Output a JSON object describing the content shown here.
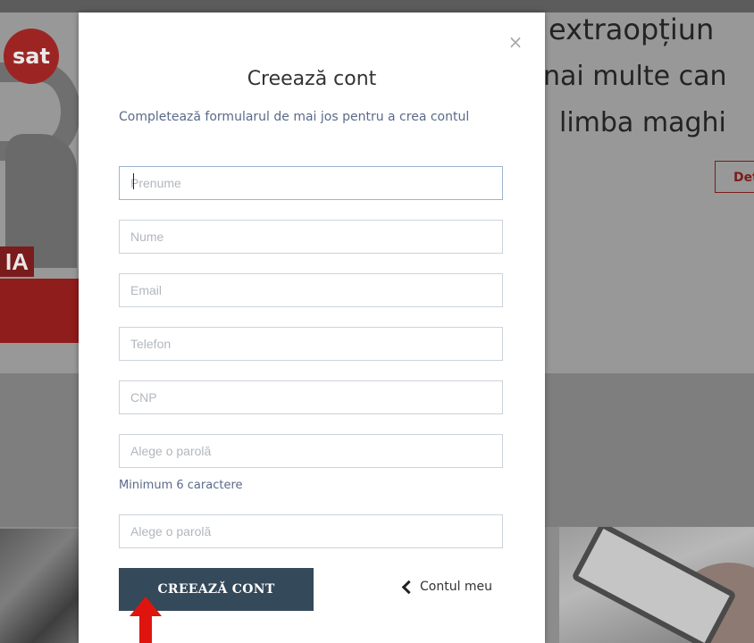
{
  "background": {
    "logo_text": "sat",
    "badge_text": "IA",
    "hero_lines": [
      "extraopțiun",
      "nai multe can",
      "limba maghi"
    ],
    "details_button": "Det"
  },
  "modal": {
    "title": "Creează cont",
    "subtitle": "Completează formularul de mai jos pentru a crea contul",
    "close_glyph": "×",
    "fields": {
      "first_name": "Prenume",
      "last_name": "Nume",
      "email": "Email",
      "phone": "Telefon",
      "cnp": "CNP",
      "password": "Alege o parolă",
      "password_confirm": "Alege o parolă"
    },
    "password_hint": "Minimum 6 caractere",
    "submit_label": "CREEAZĂ CONT",
    "account_link": "Contul meu"
  },
  "icons": {
    "close": "close-icon",
    "chevron": "chevron-left-icon",
    "annotation": "red-arrow-up-icon"
  },
  "colors": {
    "button_bg": "#34495a",
    "link_text": "#5a6a8a",
    "brand_red": "#8f1d1c",
    "arrow_red": "#e0140e"
  }
}
